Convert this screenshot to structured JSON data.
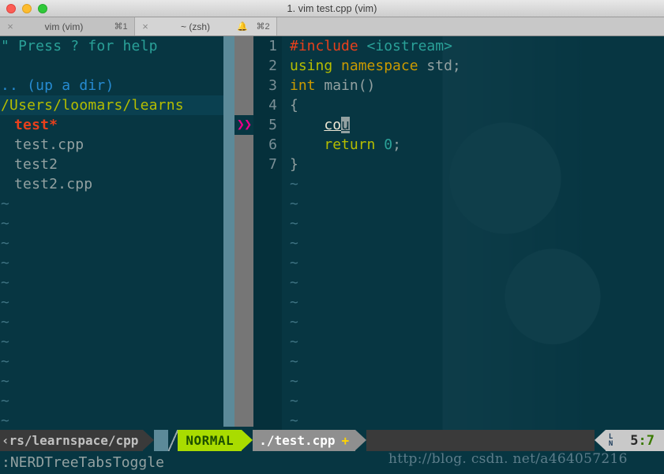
{
  "window": {
    "title": "1. vim test.cpp (vim)",
    "traffic_lights": [
      "close",
      "minimize",
      "zoom"
    ],
    "colors": {
      "titlebar_bg": "#dcdcdc",
      "terminal_bg": "#073642"
    }
  },
  "tabs": [
    {
      "label": "vim (vim)",
      "shortcut": "⌘1",
      "close": "×",
      "bell": "",
      "active": true
    },
    {
      "label": "~ (zsh)",
      "shortcut": "⌘2",
      "close": "×",
      "bell": "🔔",
      "active": false
    }
  ],
  "nerdtree": {
    "help_line": "\" Press ? for help",
    "up_a_dir": ".. (up a dir)",
    "root_path": "/Users/loomars/learns",
    "entries": [
      {
        "name": "test*",
        "kind": "executable"
      },
      {
        "name": "test.cpp",
        "kind": "file"
      },
      {
        "name": "test2",
        "kind": "file"
      },
      {
        "name": "test2.cpp",
        "kind": "file"
      }
    ],
    "filler_char": "~",
    "filler_count": 12
  },
  "fold_column": {
    "marker": "❯❯",
    "marker_line": 5,
    "marker_color": "#ec008c"
  },
  "editor": {
    "line_numbers": [
      "1",
      "2",
      "3",
      "4",
      "5",
      "6",
      "7"
    ],
    "lines": [
      {
        "n": "1",
        "tokens": [
          {
            "t": "#include ",
            "c": "s-pre"
          },
          {
            "t": "<iostream>",
            "c": "s-inc"
          }
        ]
      },
      {
        "n": "2",
        "tokens": [
          {
            "t": "using ",
            "c": "s-kw"
          },
          {
            "t": "namespace ",
            "c": "s-type"
          },
          {
            "t": "std;",
            "c": "s-id"
          }
        ]
      },
      {
        "n": "3",
        "tokens": [
          {
            "t": "int ",
            "c": "s-type"
          },
          {
            "t": "main()",
            "c": "s-fn"
          }
        ]
      },
      {
        "n": "4",
        "tokens": [
          {
            "t": "{",
            "c": "s-punct"
          }
        ]
      },
      {
        "n": "5",
        "tokens": [
          {
            "t": "    ",
            "c": "s-punct"
          },
          {
            "t": "co",
            "c": "s-spell"
          },
          {
            "t": "u",
            "c": "s-cursor"
          }
        ]
      },
      {
        "n": "6",
        "tokens": [
          {
            "t": "    ",
            "c": "s-punct"
          },
          {
            "t": "return ",
            "c": "s-kw"
          },
          {
            "t": "0",
            "c": "s-num"
          },
          {
            "t": ";",
            "c": "s-id"
          }
        ]
      },
      {
        "n": "7",
        "tokens": [
          {
            "t": "}",
            "c": "s-punct"
          }
        ]
      }
    ],
    "filler_char": "~",
    "filler_count": 13,
    "cursor_text": "cou"
  },
  "statusline": {
    "path": "‹rs/learnspace/cpp",
    "mode": "NORMAL",
    "filename": "./test.cpp",
    "modified_flag": "+",
    "position_glyph_top": "L",
    "position_glyph_bottom": "N",
    "position_row": "5",
    "position_separator": ":",
    "position_col": "7",
    "colors": {
      "mode_bg": "#a9dc00",
      "mode_fg": "#1d5000",
      "file_bg": "#8f8f8f",
      "path_bg": "#3a3a3a"
    }
  },
  "commandline": {
    "text": ":NERDTreeTabsToggle"
  },
  "watermark": {
    "text": "http://blog. csdn. net/a464057216"
  }
}
